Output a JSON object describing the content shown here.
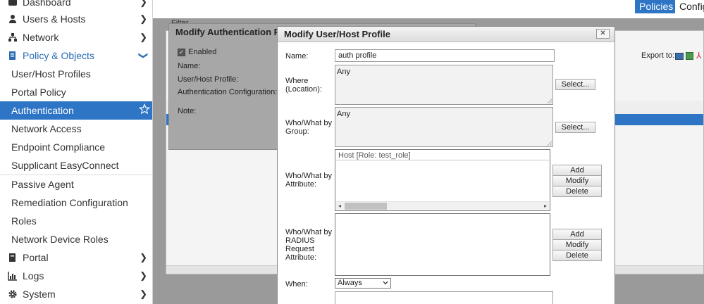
{
  "sidebar": {
    "items": [
      {
        "label": "Dashboard",
        "icon": "dashboard-icon"
      },
      {
        "label": "Users & Hosts",
        "icon": "user-icon"
      },
      {
        "label": "Network",
        "icon": "network-icon"
      },
      {
        "label": "Policy & Objects",
        "icon": "policy-icon"
      },
      {
        "label": "User/Host Profiles"
      },
      {
        "label": "Portal Policy"
      },
      {
        "label": "Authentication"
      },
      {
        "label": "Network Access"
      },
      {
        "label": "Endpoint Compliance"
      },
      {
        "label": "Supplicant EasyConnect"
      },
      {
        "label": "Passive Agent"
      },
      {
        "label": "Remediation Configuration"
      },
      {
        "label": "Roles"
      },
      {
        "label": "Network Device Roles"
      },
      {
        "label": "Portal",
        "icon": "portal-icon"
      },
      {
        "label": "Logs",
        "icon": "logs-icon"
      },
      {
        "label": "System",
        "icon": "gear-icon"
      }
    ]
  },
  "topbar": {
    "tabs": [
      {
        "label": "Policies"
      },
      {
        "label": "Configu"
      }
    ]
  },
  "background": {
    "filter_label": "Filter",
    "export_label": "Export to:"
  },
  "modal_auth": {
    "title": "Modify Authentication Po",
    "enabled_label": "Enabled",
    "name_label": "Name:",
    "profile_label": "User/Host Profile:",
    "auth_config_label": "Authentication Configuration:",
    "note_label": "Note:"
  },
  "modal_profile": {
    "title": "Modify User/Host Profile",
    "close_label": "✕",
    "name_label": "Name:",
    "name_value": "auth profile",
    "where_label": "Where (Location):",
    "where_value": "Any",
    "group_label": "Who/What by Group:",
    "group_value": "Any",
    "select_label": "Select...",
    "attribute_label": "Who/What by Attribute:",
    "attribute_rows": [
      "Host [Role: test_role]"
    ],
    "radius_label": "Who/What by RADIUS Request Attribute:",
    "add_label": "Add",
    "modify_label": "Modify",
    "delete_label": "Delete",
    "when_label": "When:",
    "when_value": "Always"
  },
  "colors": {
    "accent": "#2e75c6",
    "sidebar_bg": "#ffffff",
    "overlay_grey": "#9a9a9a"
  }
}
